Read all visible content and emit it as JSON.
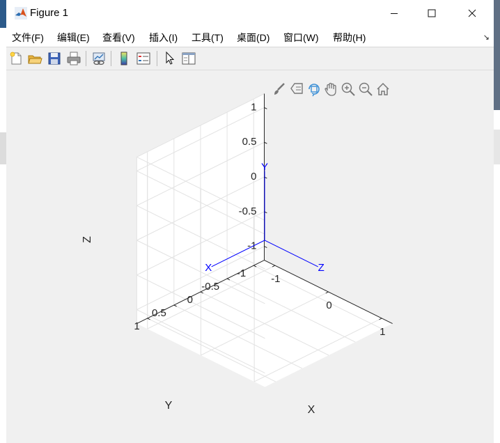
{
  "window": {
    "title": "Figure 1",
    "controls": {
      "minimize": "minimize",
      "maximize": "maximize",
      "close": "close"
    }
  },
  "menubar": {
    "items": [
      {
        "label": "文件(F)"
      },
      {
        "label": "编辑(E)"
      },
      {
        "label": "查看(V)"
      },
      {
        "label": "插入(I)"
      },
      {
        "label": "工具(T)"
      },
      {
        "label": "桌面(D)"
      },
      {
        "label": "窗口(W)"
      },
      {
        "label": "帮助(H)"
      }
    ]
  },
  "toolbar": {
    "buttons": [
      "new-figure-icon",
      "open-file-icon",
      "save-icon",
      "print-icon",
      "link-plot-icon",
      "colorbar-icon",
      "legend-icon",
      "edit-plot-cursor-icon",
      "property-inspector-icon"
    ]
  },
  "axes_toolbar": {
    "buttons": [
      "brush-icon",
      "data-tips-icon",
      "rotate-3d-icon",
      "pan-icon",
      "zoom-in-icon",
      "zoom-out-icon",
      "home-icon"
    ],
    "active": "rotate-3d-icon"
  },
  "chart_data": {
    "type": "line",
    "projection": "3d",
    "title": "",
    "xlabel": "X",
    "ylabel": "Y",
    "zlabel": "Z",
    "xlim": [
      -1.2,
      1.2
    ],
    "ylim": [
      -1.2,
      1.2
    ],
    "zlim": [
      -1.2,
      1.2
    ],
    "xticks": [
      "-1",
      "0",
      "1"
    ],
    "yticks": [
      "-1",
      "-0.5",
      "0",
      "0.5",
      "1"
    ],
    "zticks": [
      "-1",
      "-0.5",
      "0",
      "0.5",
      "1"
    ],
    "grid": true,
    "line_color": "#0000ff",
    "series": [
      {
        "label": "X",
        "from": [
          0,
          0,
          0
        ],
        "to": [
          0,
          1,
          0
        ]
      },
      {
        "label": "Y",
        "from": [
          0,
          0,
          0
        ],
        "to": [
          0,
          0,
          1
        ]
      },
      {
        "label": "Z",
        "from": [
          0,
          0,
          0
        ],
        "to": [
          1,
          0,
          0
        ]
      }
    ]
  }
}
